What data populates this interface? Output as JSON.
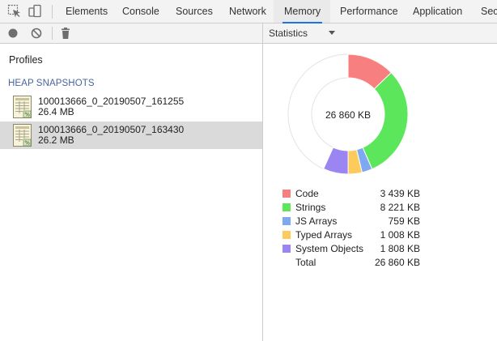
{
  "tabs": [
    {
      "label": "Elements"
    },
    {
      "label": "Console"
    },
    {
      "label": "Sources"
    },
    {
      "label": "Network"
    },
    {
      "label": "Memory",
      "active": true
    },
    {
      "label": "Performance"
    },
    {
      "label": "Application"
    },
    {
      "label": "Sec"
    }
  ],
  "toolbar": {
    "view_select": "Statistics"
  },
  "left_panel": {
    "heading": "Profiles",
    "section": "HEAP SNAPSHOTS",
    "snapshots": [
      {
        "name": "100013666_0_20190507_161255",
        "size": "26.4 MB",
        "selected": false
      },
      {
        "name": "100013666_0_20190507_163430",
        "size": "26.2 MB",
        "selected": true
      }
    ]
  },
  "statistics": {
    "total_center": "26 860 KB",
    "items": [
      {
        "label": "Code",
        "value": "3 439 KB",
        "kb": 3439,
        "color": "#f77f7f"
      },
      {
        "label": "Strings",
        "value": "8 221 KB",
        "kb": 8221,
        "color": "#5be65b"
      },
      {
        "label": "JS Arrays",
        "value": "759 KB",
        "kb": 759,
        "color": "#7ea9f2"
      },
      {
        "label": "Typed Arrays",
        "value": "1 008 KB",
        "kb": 1008,
        "color": "#fccb5b"
      },
      {
        "label": "System Objects",
        "value": "1 808 KB",
        "kb": 1808,
        "color": "#9a85f2"
      }
    ],
    "total": {
      "label": "Total",
      "value": "26 860 KB",
      "kb": 26860
    }
  }
}
